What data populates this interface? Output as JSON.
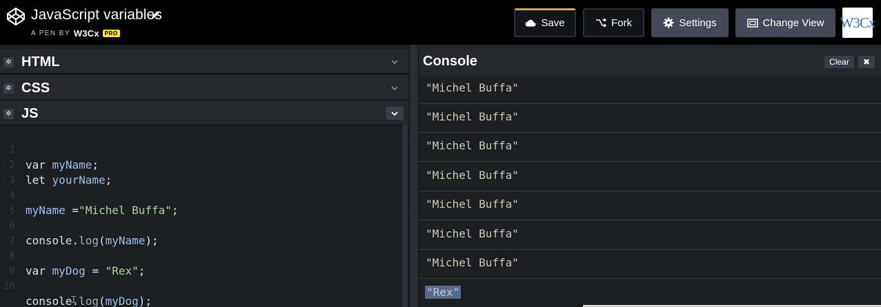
{
  "header": {
    "pen_title": "JavaScript variables",
    "byline_prefix": "A PEN BY",
    "author": "W3Cx",
    "pro_badge": "PRO",
    "buttons": {
      "save": "Save",
      "fork": "Fork",
      "settings": "Settings",
      "change_view": "Change View"
    },
    "avatar_text": "W3Cx"
  },
  "editors": [
    {
      "label": "HTML",
      "collapsed": true
    },
    {
      "label": "CSS",
      "collapsed": true
    },
    {
      "label": "JS",
      "collapsed": false
    }
  ],
  "js_code": {
    "line_numbers": [
      "1",
      "2",
      "3",
      "4",
      "5",
      "6",
      "7",
      "8",
      "9",
      "10"
    ],
    "lines": [
      {
        "keyword": "var",
        "name": "myName",
        "end": ";"
      },
      {
        "keyword": "let",
        "name": "yourName",
        "end": ";"
      },
      {
        "assign_name": "myName",
        "assign_op": " =",
        "assign_str": "\"Michel Buffa\"",
        "end": ";"
      },
      {
        "obj": "console",
        "method": "log",
        "arg": "myName",
        "end": ");"
      },
      {
        "keyword": "var",
        "name": "myDog",
        "op": " = ",
        "str": "\"Rex\"",
        "end": ";"
      },
      {
        "obj": "console",
        "method": "log",
        "arg": "myDog",
        "end": ");"
      }
    ]
  },
  "console": {
    "title": "Console",
    "clear_label": "Clear",
    "close_label": "✖",
    "entries": [
      "\"Michel Buffa\"",
      "\"Michel Buffa\"",
      "\"Michel Buffa\"",
      "\"Michel Buffa\"",
      "\"Michel Buffa\"",
      "\"Michel Buffa\"",
      "\"Michel Buffa\"",
      "\"Rex\""
    ]
  },
  "colors": {
    "save_accent": "#c9a95b",
    "pro_badge": "#ffdd40",
    "selection": "#566b8c"
  },
  "icons": [
    "codepen-logo-icon",
    "pencil-icon",
    "cloud-icon",
    "fork-icon",
    "gear-icon",
    "layout-icon",
    "chevron-down-icon",
    "close-icon"
  ]
}
